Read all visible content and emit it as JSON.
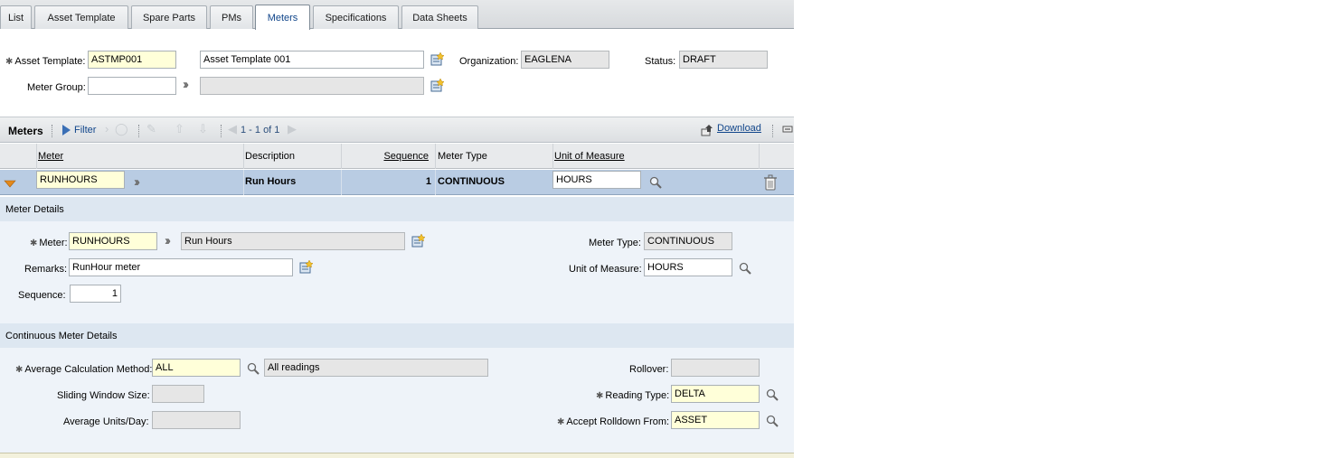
{
  "tabs": [
    {
      "label": "List"
    },
    {
      "label": "Asset Template"
    },
    {
      "label": "Spare Parts"
    },
    {
      "label": "PMs"
    },
    {
      "label": "Meters"
    },
    {
      "label": "Specifications"
    },
    {
      "label": "Data Sheets"
    }
  ],
  "header": {
    "asset_template_label": "Asset Template:",
    "asset_template_code": "ASTMP001",
    "asset_template_desc": "Asset Template 001",
    "organization_label": "Organization:",
    "organization_value": "EAGLENA",
    "status_label": "Status:",
    "status_value": "DRAFT",
    "meter_group_label": "Meter Group:",
    "meter_group_value": "",
    "meter_group_desc": ""
  },
  "toolbar": {
    "title": "Meters",
    "filter_label": "Filter",
    "pager": "1 - 1 of 1",
    "download_label": "Download"
  },
  "grid": {
    "columns": [
      "Meter",
      "Description",
      "Sequence",
      "Meter Type",
      "Unit of Measure"
    ],
    "rows": [
      {
        "meter": "RUNHOURS",
        "description": "Run Hours",
        "sequence": "1",
        "meter_type": "CONTINUOUS",
        "uom": "HOURS"
      }
    ]
  },
  "meter_details": {
    "section_title": "Meter Details",
    "meter_label": "Meter:",
    "meter_value": "RUNHOURS",
    "meter_desc": "Run Hours",
    "remarks_label": "Remarks:",
    "remarks_value": "RunHour meter",
    "sequence_label": "Sequence:",
    "sequence_value": "1",
    "meter_type_label": "Meter Type:",
    "meter_type_value": "CONTINUOUS",
    "uom_label": "Unit of Measure:",
    "uom_value": "HOURS"
  },
  "continuous": {
    "section_title": "Continuous Meter Details",
    "avg_calc_label": "Average Calculation Method:",
    "avg_calc_value": "ALL",
    "avg_calc_desc": "All readings",
    "sliding_label": "Sliding Window Size:",
    "sliding_value": "",
    "avg_units_label": "Average Units/Day:",
    "avg_units_value": "",
    "rollover_label": "Rollover:",
    "rollover_value": "",
    "reading_type_label": "Reading Type:",
    "reading_type_value": "DELTA",
    "rolldown_label": "Accept Rolldown From:",
    "rolldown_value": "ASSET"
  },
  "colors": {
    "accent": "#10458a",
    "row_selected": "#b9cce3",
    "section_bg": "#eef3f9",
    "required_field": "#ffffd9"
  }
}
